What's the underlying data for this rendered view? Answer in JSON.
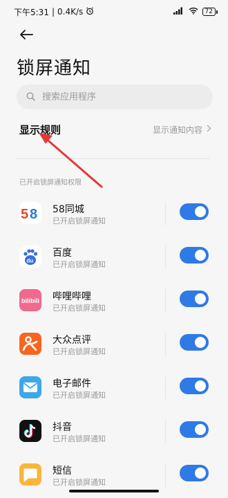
{
  "status_bar": {
    "time": "下午5:31",
    "speed": "0.4K/s",
    "battery": "72"
  },
  "page": {
    "title": "锁屏通知"
  },
  "search": {
    "placeholder": "搜索应用程序"
  },
  "rules": {
    "title": "显示规则",
    "value": "显示通知内容"
  },
  "section": {
    "label": "已开启锁屏通知权限"
  },
  "apps": [
    {
      "name": "58同城",
      "subtitle": "已开启锁屏通知",
      "enabled": true
    },
    {
      "name": "百度",
      "subtitle": "已开启锁屏通知",
      "enabled": true
    },
    {
      "name": "哔哩哔哩",
      "subtitle": "已开启锁屏通知",
      "enabled": true
    },
    {
      "name": "大众点评",
      "subtitle": "已开启锁屏通知",
      "enabled": true
    },
    {
      "name": "电子邮件",
      "subtitle": "已开启锁屏通知",
      "enabled": true
    },
    {
      "name": "抖音",
      "subtitle": "已开启锁屏通知",
      "enabled": true
    },
    {
      "name": "短信",
      "subtitle": "已开启锁屏通知",
      "enabled": true
    }
  ],
  "icon_names": [
    "58-tongcheng-icon",
    "baidu-icon",
    "bilibili-icon",
    "dianping-icon",
    "email-icon",
    "douyin-icon",
    "sms-icon"
  ],
  "colors": {
    "toggle_on": "#2e7ae6",
    "annotation": "#e53935"
  }
}
